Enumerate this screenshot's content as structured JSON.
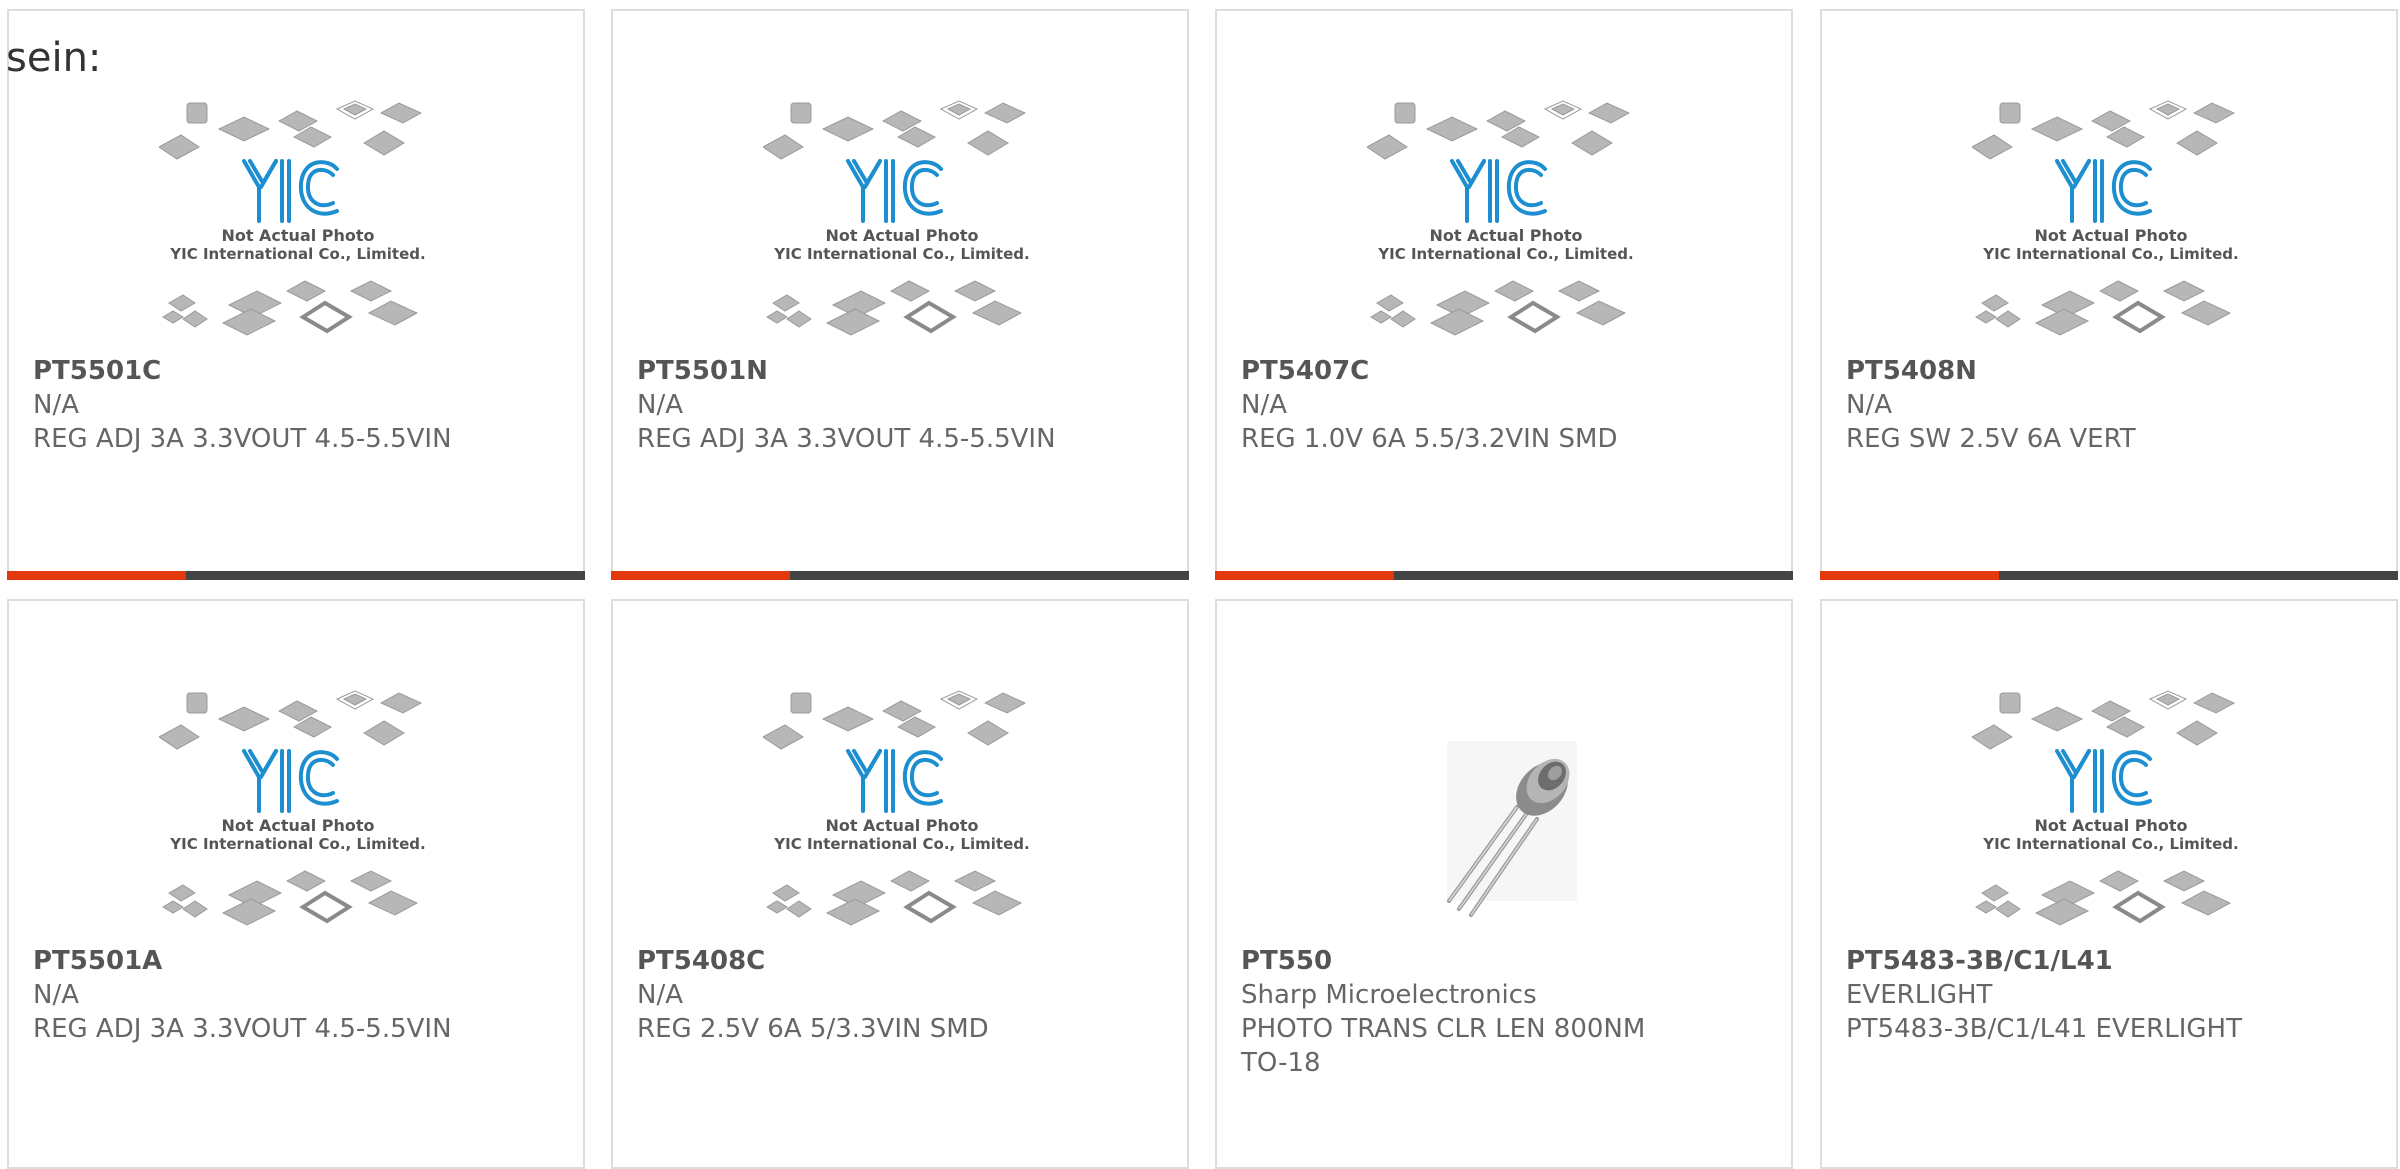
{
  "lead_text": "sein:",
  "placeholder": {
    "brand": "YIC",
    "caption_line1": "Not Actual Photo",
    "caption_line2": "YIC International Co., Limited."
  },
  "colors": {
    "accent": "#e23a0e",
    "bar": "#444444",
    "brand_blue": "#1d8fd0",
    "text": "#666666"
  },
  "products": [
    {
      "part": "PT5501C",
      "manufacturer": "N/A",
      "description": "REG ADJ 3A 3.3VOUT 4.5-5.5VIN",
      "image": "placeholder"
    },
    {
      "part": "PT5501N",
      "manufacturer": "N/A",
      "description": "REG ADJ 3A 3.3VOUT 4.5-5.5VIN",
      "image": "placeholder"
    },
    {
      "part": "PT5407C",
      "manufacturer": "N/A",
      "description": "REG 1.0V 6A 5.5/3.2VIN SMD",
      "image": "placeholder"
    },
    {
      "part": "PT5408N",
      "manufacturer": "N/A",
      "description": "REG SW 2.5V 6A VERT",
      "image": "placeholder"
    },
    {
      "part": "PT5501A",
      "manufacturer": "N/A",
      "description": "REG ADJ 3A 3.3VOUT 4.5-5.5VIN",
      "image": "placeholder"
    },
    {
      "part": "PT5408C",
      "manufacturer": "N/A",
      "description": "REG 2.5V 6A 5/3.3VIN SMD",
      "image": "placeholder"
    },
    {
      "part": "PT550",
      "manufacturer": "Sharp Microelectronics",
      "description": "PHOTO TRANS CLR LEN 800NM TO-18",
      "image": "phototransistor"
    },
    {
      "part": "PT5483-3B/C1/L41",
      "manufacturer": "EVERLIGHT",
      "description": "PT5483-3B/C1/L41 EVERLIGHT",
      "image": "placeholder"
    }
  ],
  "row_accent_fraction": [
    0.31,
    0.31,
    0.31,
    0.31
  ]
}
